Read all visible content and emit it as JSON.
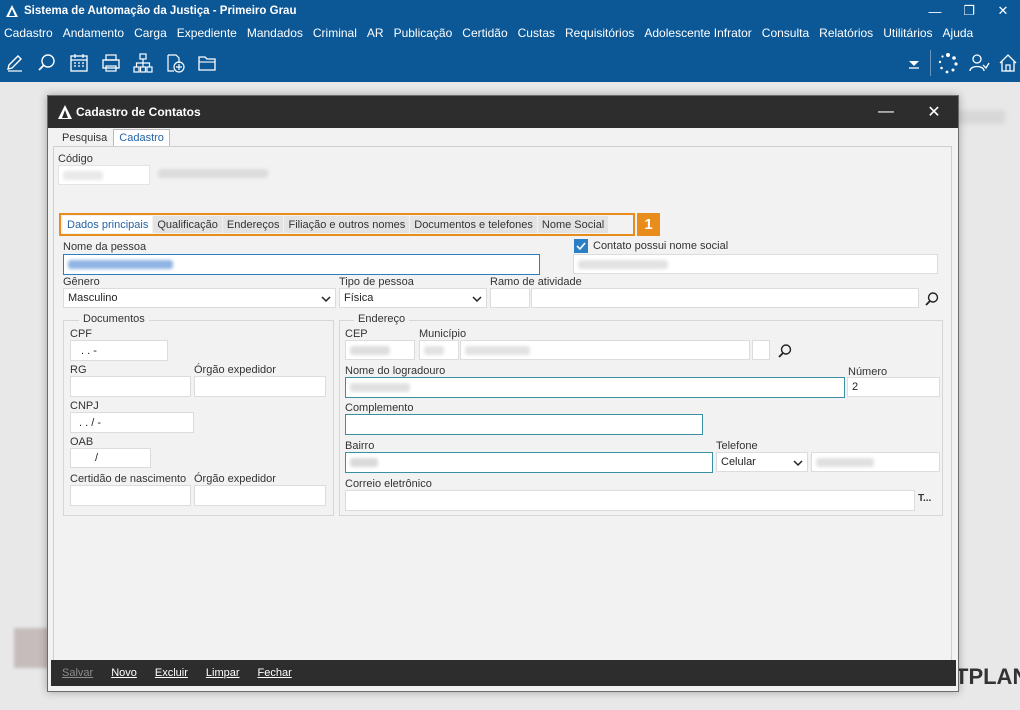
{
  "app": {
    "title": "Sistema de Automação da Justiça - Primeiro Grau",
    "menu": [
      "Cadastro",
      "Andamento",
      "Carga",
      "Expediente",
      "Mandados",
      "Criminal",
      "AR",
      "Publicação",
      "Certidão",
      "Custas",
      "Requisitórios",
      "Adolescente Infrator",
      "Consulta",
      "Relatórios",
      "Utilitários",
      "Ajuda"
    ],
    "toolbar_icons": [
      "edit-icon",
      "search-process-icon",
      "calendar-icon",
      "printer-icon",
      "org-chart-icon",
      "add-document-icon",
      "folder-icon",
      "dropdown-icon",
      "loading-icon",
      "users-icon",
      "home-icon"
    ],
    "logo_text": "TPLAN"
  },
  "dialog": {
    "title": "Cadastro de Contatos",
    "tabs": [
      "Pesquisa",
      "Cadastro"
    ],
    "active_tab": "Cadastro",
    "codigo_label": "Código",
    "subtabs": [
      "Dados principais",
      "Qualificação",
      "Endereços",
      "Filiação e outros nomes",
      "Documentos e telefones",
      "Nome Social"
    ],
    "active_subtab": "Dados principais",
    "callout_number": "1",
    "nome_label": "Nome da pessoa",
    "nome_social_checkbox_label": "Contato possui nome social",
    "nome_social_checked": true,
    "genero_label": "Gênero",
    "genero_value": "Masculino",
    "tipo_label": "Tipo de pessoa",
    "tipo_value": "Física",
    "ramo_label": "Ramo de atividade",
    "documentos": {
      "title": "Documentos",
      "cpf_label": "CPF",
      "cpf_mask": ".   .   -",
      "rg_label": "RG",
      "orgao_label": "Órgão expedidor",
      "cnpj_label": "CNPJ",
      "cnpj_mask": ".   .   /    -",
      "oab_label": "OAB",
      "oab_mask": "/",
      "certidao_label": "Certidão de nascimento",
      "orgao2_label": "Órgão expedidor"
    },
    "endereco": {
      "title": "Endereço",
      "cep_label": "CEP",
      "municipio_label": "Município",
      "logradouro_label": "Nome do logradouro",
      "numero_label": "Número",
      "numero_value": "2",
      "complemento_label": "Complemento",
      "bairro_label": "Bairro",
      "telefone_label": "Telefone",
      "telefone_tipo": "Celular",
      "email_label": "Correio eletrônico",
      "email_button": "T..."
    },
    "footer_buttons": [
      "Salvar",
      "Novo",
      "Excluir",
      "Limpar",
      "Fechar"
    ],
    "accent_color": "#e88d1b",
    "header_color": "#0c5796"
  }
}
